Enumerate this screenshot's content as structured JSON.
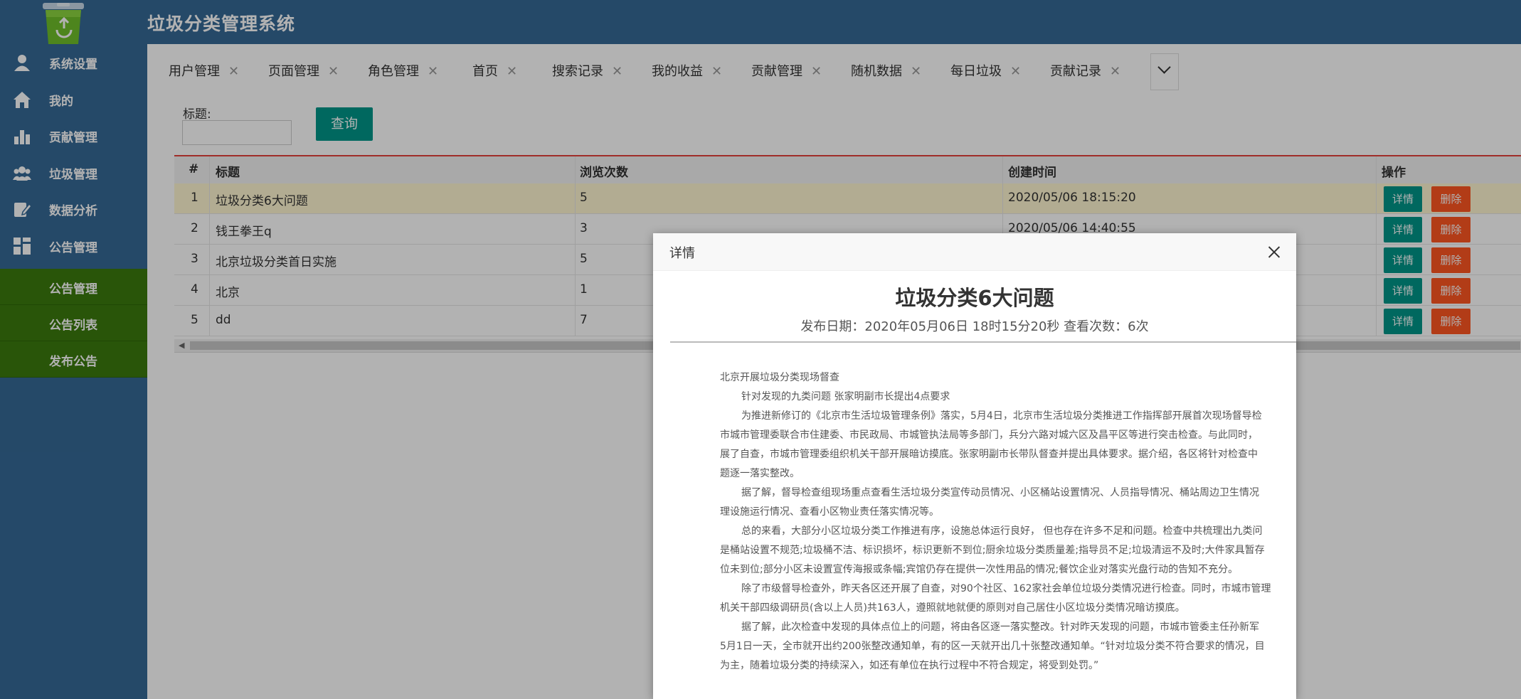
{
  "app": {
    "title": "垃圾分类管理系统"
  },
  "sidebar": {
    "items": [
      {
        "label": "系统设置",
        "icon": "user-icon"
      },
      {
        "label": "我的",
        "icon": "home-icon"
      },
      {
        "label": "贡献管理",
        "icon": "bar-chart-icon"
      },
      {
        "label": "垃圾管理",
        "icon": "users-icon"
      },
      {
        "label": "数据分析",
        "icon": "edit-icon"
      },
      {
        "label": "公告管理",
        "icon": "grid-icon"
      }
    ],
    "subitems": [
      {
        "label": "公告管理"
      },
      {
        "label": "公告列表"
      },
      {
        "label": "发布公告"
      }
    ]
  },
  "tabs": [
    {
      "label": "用户管理"
    },
    {
      "label": "页面管理"
    },
    {
      "label": "角色管理"
    },
    {
      "label": "首页"
    },
    {
      "label": "搜索记录"
    },
    {
      "label": "我的收益"
    },
    {
      "label": "贡献管理"
    },
    {
      "label": "随机数据"
    },
    {
      "label": "每日垃圾"
    },
    {
      "label": "贡献记录"
    }
  ],
  "search": {
    "label": "标题:",
    "value": "",
    "button": "查询"
  },
  "table": {
    "headers": [
      "#",
      "标题",
      "浏览次数",
      "创建时间",
      "操作"
    ],
    "rows": [
      {
        "no": "1",
        "title": "垃圾分类6大问题",
        "views": "5",
        "created": "2020/05/06 18:15:20"
      },
      {
        "no": "2",
        "title": "钱王拳王q",
        "views": "3",
        "created": "2020/05/06 14:40:55"
      },
      {
        "no": "3",
        "title": "北京垃圾分类首日实施",
        "views": "5",
        "created": ""
      },
      {
        "no": "4",
        "title": "北京",
        "views": "1",
        "created": ""
      },
      {
        "no": "5",
        "title": "dd",
        "views": "7",
        "created": ""
      }
    ],
    "detail_label": "详情",
    "delete_label": "删除"
  },
  "modal": {
    "title": "详情",
    "article_title": "垃圾分类6大问题",
    "meta": "发布日期：2020年05月06日 18时15分20秒    查看次数：6次",
    "body": [
      "北京开展垃圾分类现场督查",
      "针对发现的九类问题 张家明副市长提出4点要求",
      "为推进新修订的《北京市生活垃圾管理条例》落实，5月4日，北京市生活垃圾分类推进工作指挥部开展首次现场督导检",
      "市城市管理委联合市住建委、市民政局、市城管执法局等多部门，兵分六路对城六区及昌平区等进行突击检查。与此同时，",
      "展了自查，市城市管理委组织机关干部开展暗访摸底。张家明副市长带队督查并提出具体要求。据介绍，各区将针对检查中",
      "题逐一落实整改。",
      "据了解，督导检查组现场重点查看生活垃圾分类宣传动员情况、小区桶站设置情况、人员指导情况、桶站周边卫生情况",
      "理设施运行情况、查看小区物业责任落实情况等。",
      "总的来看，大部分小区垃圾分类工作推进有序，设施总体运行良好， 但也存在许多不足和问题。检查中共梳理出九类问",
      "是桶站设置不规范;垃圾桶不洁、标识损坏，标识更新不到位;厨余垃圾分类质量差;指导员不足;垃圾清运不及时;大件家具暂存",
      "位未到位;部分小区未设置宣传海报或条幅;宾馆仍存在提供一次性用品的情况;餐饮企业对落实光盘行动的告知不充分。",
      "除了市级督导检查外，昨天各区还开展了自查，对90个社区、162家社会单位垃圾分类情况进行检查。同时，市城市管理",
      "机关干部四级调研员(含以上人员)共163人，遵照就地就便的原则对自己居住小区垃圾分类情况暗访摸底。",
      "据了解，此次检查中发现的具体点位上的问题，将由各区逐一落实整改。针对昨天发现的问题，市城市管委主任孙新军",
      "5月1日一天，全市就开出约200张整改通知单，有的区一天就开出几十张整改通知单。“针对垃圾分类不符合要求的情况，目",
      "为主，随着垃圾分类的持续深入，如还有单位在执行过程中不符合规定，将受到处罚。”"
    ]
  },
  "colors": {
    "header_bg": "#356996",
    "sub_nav_bg": "#3b7a0d",
    "primary_btn": "#019688",
    "danger_btn": "#ff5722",
    "table_accent": "#e5413b"
  }
}
